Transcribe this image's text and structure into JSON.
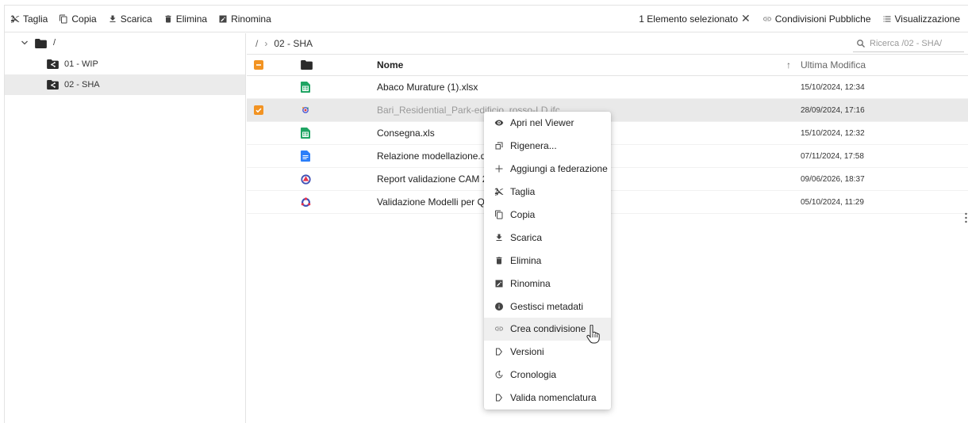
{
  "toolbar": {
    "left": [
      {
        "label": "Taglia",
        "icon": "scissors-icon"
      },
      {
        "label": "Copia",
        "icon": "copy-icon"
      },
      {
        "label": "Scarica",
        "icon": "download-icon"
      },
      {
        "label": "Elimina",
        "icon": "trash-icon"
      },
      {
        "label": "Rinomina",
        "icon": "rename-icon"
      }
    ],
    "selection_text": "1 Elemento selezionato",
    "public_shares_label": "Condivisioni Pubbliche",
    "view_label": "Visualizzazione"
  },
  "tree": {
    "root_label": "/",
    "items": [
      {
        "label": "01 - WIP"
      },
      {
        "label": "02 - SHA"
      }
    ]
  },
  "breadcrumb": {
    "root": "/",
    "current": "02 - SHA"
  },
  "search": {
    "placeholder": "Ricerca /02 - SHA/"
  },
  "table": {
    "col_name": "Nome",
    "col_modified": "Ultima Modifica",
    "sort_arrow": "↑",
    "rows": [
      {
        "name": "Abaco Murature (1).xlsx",
        "date": "15/10/2024, 12:34",
        "icon": "spreadsheet-icon"
      },
      {
        "name": "Bari_Residential_Park-edificio_rosso-LD.ifc",
        "date": "28/09/2024, 17:16",
        "icon": "ifc-model-icon",
        "selected": true
      },
      {
        "name": "Consegna.xls",
        "date": "15/10/2024, 12:32",
        "icon": "spreadsheet-icon"
      },
      {
        "name": "Relazione modellazione.doc",
        "date": "07/11/2024, 17:58",
        "icon": "document-icon"
      },
      {
        "name": "Report validazione CAM 2.5",
        "date": "09/06/2026, 18:37",
        "icon": "report-icon"
      },
      {
        "name": "Validazione Modelli per QTO",
        "date": "05/10/2024, 11:29",
        "icon": "validation-icon"
      }
    ]
  },
  "context_menu": {
    "items": [
      {
        "label": "Apri nel Viewer",
        "icon": "eye-icon"
      },
      {
        "label": "Rigenera...",
        "icon": "regenerate-icon"
      },
      {
        "label": "Aggiungi a federazione",
        "icon": "plus-icon"
      },
      {
        "label": "Taglia",
        "icon": "scissors-icon"
      },
      {
        "label": "Copia",
        "icon": "copy-icon"
      },
      {
        "label": "Scarica",
        "icon": "download-icon"
      },
      {
        "label": "Elimina",
        "icon": "trash-icon"
      },
      {
        "label": "Rinomina",
        "icon": "rename-icon"
      },
      {
        "label": "Gestisci metadati",
        "icon": "info-icon"
      },
      {
        "label": "Crea condivisione",
        "icon": "share-link-icon",
        "hover": true
      },
      {
        "label": "Versioni",
        "icon": "versions-icon"
      },
      {
        "label": "Cronologia",
        "icon": "history-icon"
      },
      {
        "label": "Valida nomenclatura",
        "icon": "validate-icon"
      }
    ]
  },
  "colors": {
    "accent": "#f29322",
    "sheet_green": "#1fa463",
    "doc_blue": "#2d7ff9"
  }
}
